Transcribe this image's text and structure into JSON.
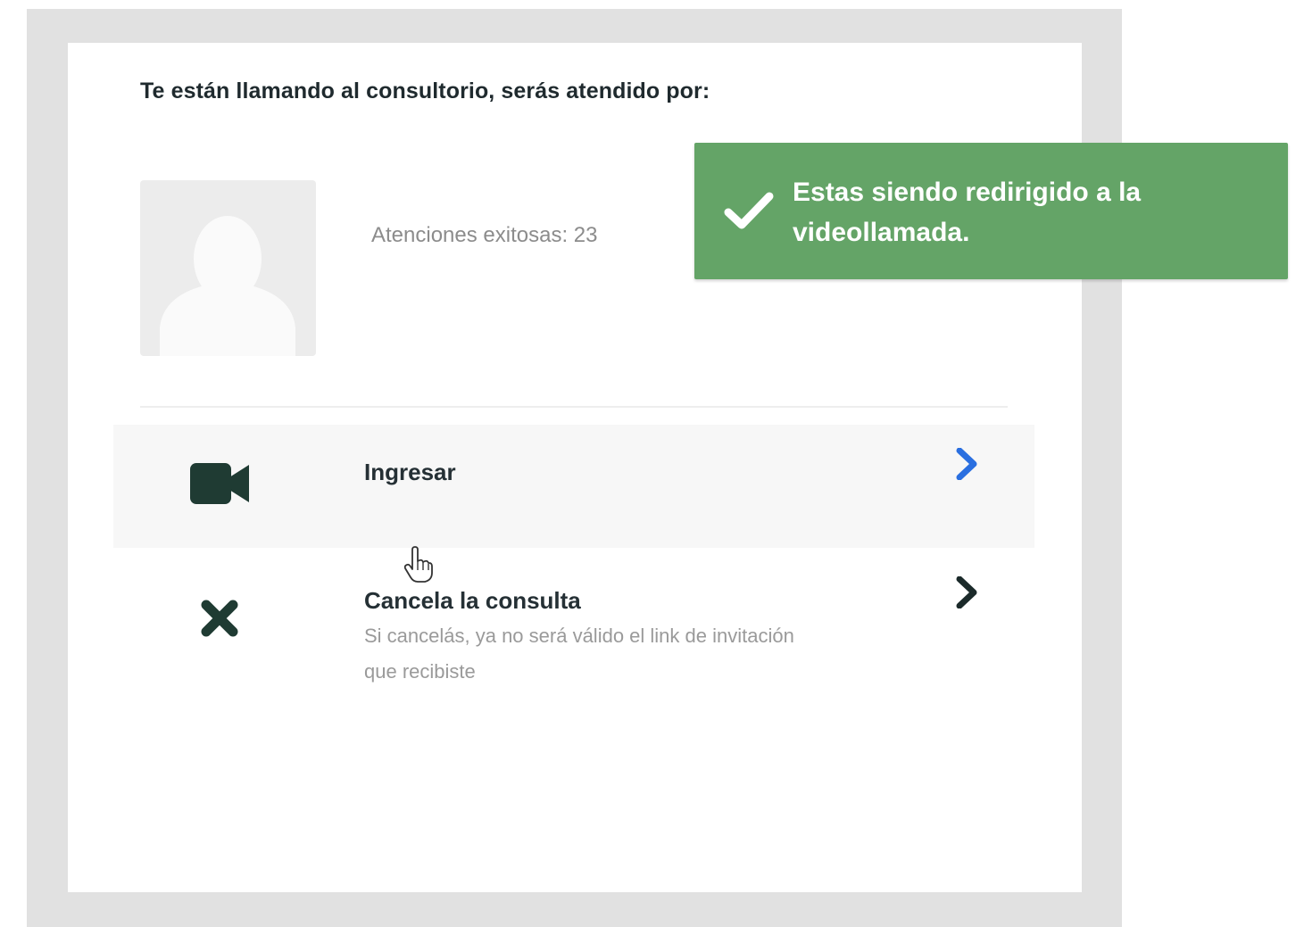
{
  "modal": {
    "heading": "Te están llamando al consultorio, serás atendido por:",
    "avatar_icon": "user-silhouette-icon",
    "stats_text": "Atenciones exitosas: 23"
  },
  "options": [
    {
      "icon": "video-camera-icon",
      "title": "Ingresar",
      "chevron_color": "#2a6fe0"
    },
    {
      "icon": "close-icon",
      "title": "Cancela la consulta",
      "description": "Si cancelás, ya no será válido el link de invitación que recibiste",
      "chevron_color": "#1b2a2a"
    }
  ],
  "toast": {
    "icon": "checkmark-icon",
    "message": "Estas siendo redirigido a la videollamada.",
    "color": "#64a467"
  },
  "colors": {
    "frame": "#e1e1e1",
    "icon_dark": "#1f3b33",
    "highlight_row": "#f7f7f7"
  }
}
